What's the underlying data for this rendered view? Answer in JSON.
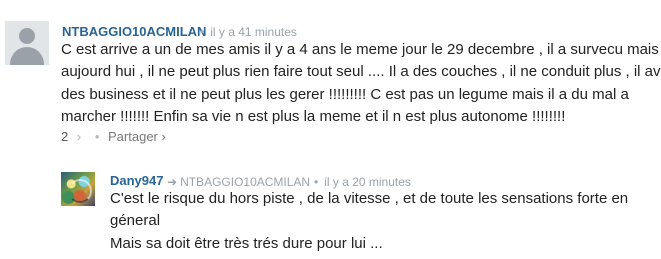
{
  "comments": [
    {
      "author": "NTBAGGIO10ACMILAN",
      "time": "il y a 41 minutes",
      "avatar_icon": "default-user-avatar-icon",
      "lines": [
        "C est arrive a un de mes amis il y a 4 ans le meme jour le 29 decembre , il a survecu mais",
        "aujourd hui , il ne peut plus rien faire tout seul .... Il a des couches , il ne conduit plus , il avait",
        "des business et il ne peut plus les gerer !!!!!!!!! C est pas un legume mais il a du mal a",
        "marcher !!!!!!! Enfin sa vie n est plus la meme et il n est plus autonome !!!!!!!!"
      ],
      "vote_count": "2",
      "share_label": "Partager ›"
    },
    {
      "author": "Dany947",
      "reply_to": "NTBAGGIO10ACMILAN",
      "time": "il y a 20 minutes",
      "avatar_icon": "user-avatar-image",
      "lines": [
        "C'est le risque du hors piste , de la vitesse , et de toute les sensations forte en",
        "géneral",
        "Mais sa doit être très trés dure pour lui ..."
      ]
    }
  ],
  "colors": {
    "author": "#2a6496",
    "meta": "#9aa3ab",
    "text": "#222222"
  }
}
